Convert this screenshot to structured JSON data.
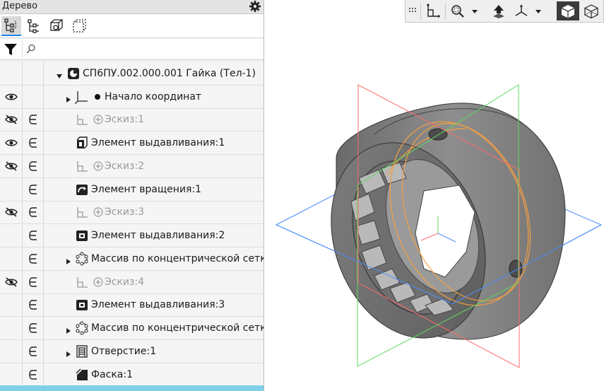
{
  "panel": {
    "title": "Дерево",
    "search_placeholder": "",
    "toolbar_icons": [
      "tree-structure-icon",
      "tree-hierarchy-icon",
      "part-view-icon",
      "selection-frame-icon"
    ]
  },
  "tree": {
    "rows": [
      {
        "label": "СП6ПУ.002.000.001 Гайка (Тел-1)",
        "visible": false,
        "dependency": false,
        "expanded": true,
        "dim": false,
        "icon": "part-icon"
      },
      {
        "label": "Начало координат",
        "visible": true,
        "dependency": false,
        "collapsed": true,
        "dim": false,
        "icon": "origin-icon"
      },
      {
        "label": "Эскиз:1",
        "visible": false,
        "hidden_icon": true,
        "dependency": true,
        "dim": true,
        "icon": "sketch-icon"
      },
      {
        "label": "Элемент выдавливания:1",
        "visible": true,
        "dependency": true,
        "dim": false,
        "icon": "extrude-icon"
      },
      {
        "label": "Эскиз:2",
        "visible": false,
        "hidden_icon": true,
        "dependency": true,
        "dim": true,
        "icon": "sketch-icon"
      },
      {
        "label": "Элемент вращения:1",
        "visible": false,
        "dependency": true,
        "dim": false,
        "icon": "revolve-icon"
      },
      {
        "label": "Эскиз:3",
        "visible": false,
        "hidden_icon": true,
        "dependency": true,
        "dim": true,
        "icon": "sketch-icon"
      },
      {
        "label": "Элемент выдавливания:2",
        "visible": false,
        "dependency": true,
        "dim": false,
        "icon": "extrude-cut-icon"
      },
      {
        "label": "Массив по концентрической сетке:",
        "visible": false,
        "dependency": true,
        "collapsed": true,
        "dim": false,
        "icon": "circular-pattern-icon"
      },
      {
        "label": "Эскиз:4",
        "visible": false,
        "hidden_icon": true,
        "dependency": true,
        "dim": true,
        "icon": "sketch-icon"
      },
      {
        "label": "Элемент выдавливания:3",
        "visible": false,
        "dependency": true,
        "dim": false,
        "icon": "extrude-cut-icon"
      },
      {
        "label": "Массив по концентрической сетке:",
        "visible": false,
        "dependency": true,
        "collapsed": true,
        "dim": false,
        "icon": "circular-pattern-icon"
      },
      {
        "label": "Отверстие:1",
        "visible": false,
        "dependency": true,
        "collapsed": true,
        "dim": false,
        "icon": "hole-icon"
      },
      {
        "label": "Фаска:1",
        "visible": false,
        "dependency": true,
        "dim": false,
        "icon": "chamfer-icon"
      }
    ]
  },
  "view_toolbar": {
    "icons": [
      "grip-icon",
      "sketch-view-icon",
      "zoom-icon",
      "dropdown-icon",
      "normal-to-icon",
      "axes-orientation-icon",
      "dropdown-icon",
      "shaded-view-icon",
      "wireframe-view-icon"
    ]
  },
  "colors": {
    "accent": "#1e87e6",
    "bottom_bar": "#7fd0e8",
    "plane_red": "#ff6b6b",
    "plane_green": "#5fdc5f",
    "plane_blue": "#4a8cff",
    "sketch_orange": "#f5a040",
    "body_gray": "#8d8d8d"
  }
}
